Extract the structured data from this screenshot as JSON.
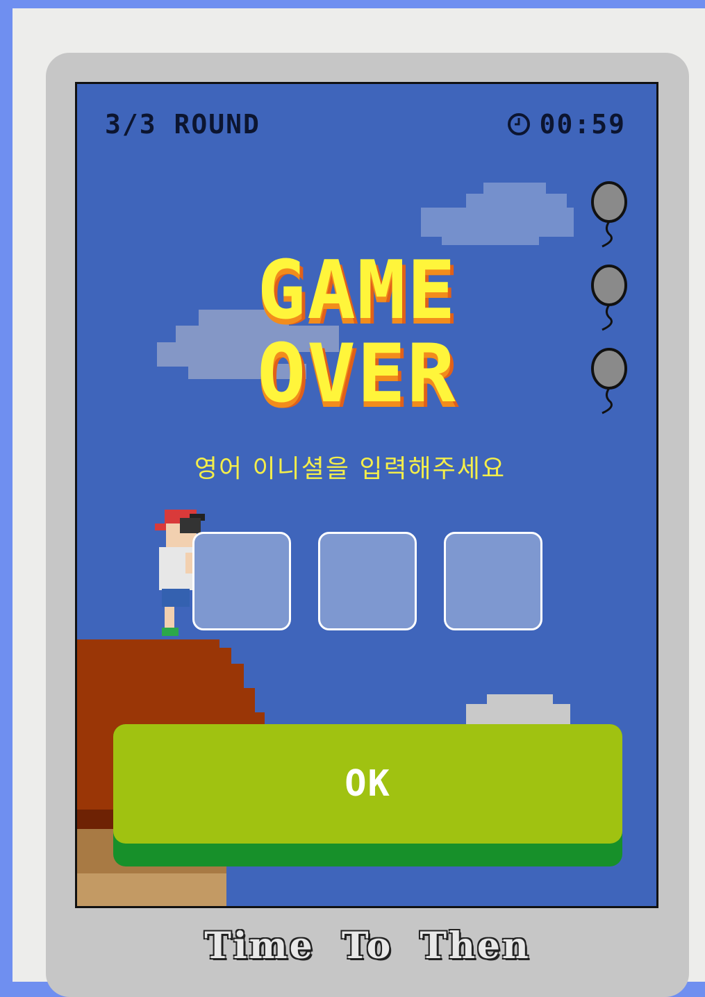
{
  "hud": {
    "round_label": "3/3 ROUND",
    "timer_icon": "clock-icon",
    "timer_value": "00:59"
  },
  "game_over": {
    "line1": "GAME",
    "line2": "OVER"
  },
  "lives": {
    "icon": "balloon-icon",
    "count": 3,
    "state": "deflated"
  },
  "prompt": "영어 이니셜을 입력해주세요",
  "initials": [
    "",
    "",
    ""
  ],
  "ok_button": {
    "label": "OK"
  },
  "footer_title": "Time To Then",
  "colors": {
    "sky": "#3f65bb",
    "title_fill": "#fff53b",
    "title_shadow": "#f28c1c",
    "prompt_text": "#f4ee4a",
    "ok_button": "#a0c211",
    "ok_button_shadow": "#17902a",
    "device_frame": "#c6c6c6"
  }
}
